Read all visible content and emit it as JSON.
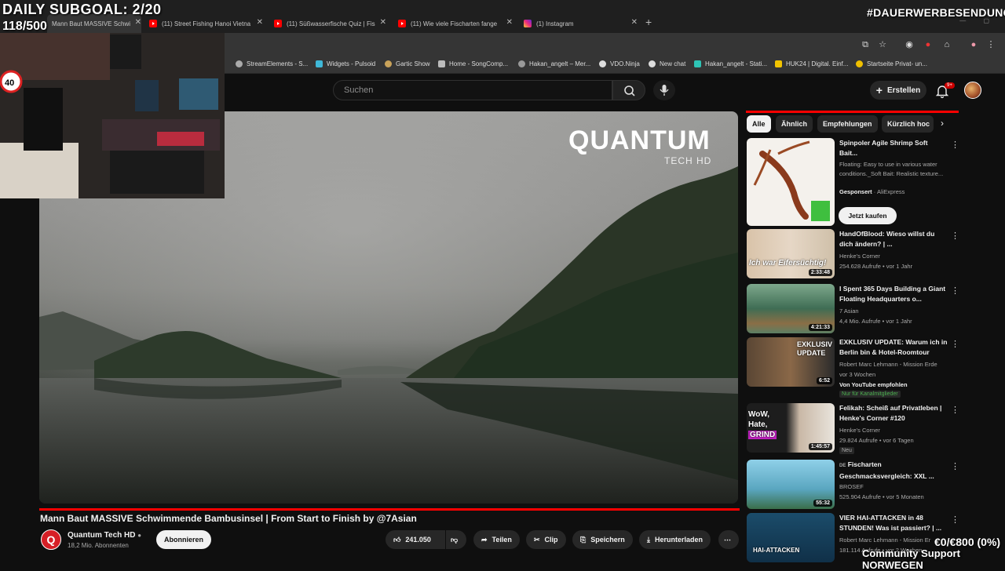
{
  "overlay": {
    "subgoal": "DAILY SUBGOAL: 2/20",
    "subcount": "118/500",
    "werbung": "#DAUERWERBESENDUNG",
    "donation": "€0/€800 (0%)",
    "support": "Community Support NORWEGEN"
  },
  "browser": {
    "tabs": [
      {
        "label": "Mann Baut MASSIVE Schwi",
        "icon": "youtube-icon",
        "active": true
      },
      {
        "label": "(11) Street Fishing Hanoi Vietna",
        "icon": "youtube-icon"
      },
      {
        "label": "(11) Süßwasserfische Quiz | Fis",
        "icon": "youtube-icon"
      },
      {
        "label": "(11) Wie viele Fischarten fange",
        "icon": "youtube-icon"
      },
      {
        "label": "(1) Instagram",
        "icon": "instagram-icon"
      }
    ],
    "bookmarks": [
      "StreamElements - S...",
      "Widgets - Pulsoid",
      "Gartic Show",
      "Home - SongComp...",
      "Hakan_angelt – Mer...",
      "VDO.Ninja",
      "New chat",
      "Hakan_angelt - Stati...",
      "HUK24 | Digital. Einf...",
      "Startseite Privat- un..."
    ]
  },
  "youtube": {
    "search_placeholder": "Suchen",
    "create_label": "Erstellen",
    "notification_count": "9+",
    "video": {
      "title": "Mann Baut MASSIVE Schwimmende Bambusinsel | From Start to Finish by @7Asian",
      "channel": "Quantum Tech HD",
      "subscribers": "18,2 Mio. Abonnenten",
      "subscribe_label": "Abonnieren",
      "likes": "241.050",
      "share_label": "Teilen",
      "clip_label": "Clip",
      "save_label": "Speichern",
      "download_label": "Herunterladen",
      "watermark_main": "QUANTUM",
      "watermark_sub": "TECH HD",
      "channel_initial": "Q"
    },
    "chips": [
      "Alle",
      "Ähnlich",
      "Empfehlungen",
      "Kürzlich hoc"
    ],
    "recommendations": [
      {
        "title": "Spinpoler Agile Shrimp Soft Bait...",
        "description": "Floating: Easy to use in various water conditions._Soft Bait: Realistic texture...",
        "sponsor": "Gesponsert",
        "advertiser": "AliExpress",
        "cta": "Jetzt kaufen"
      },
      {
        "title": "HandOfBlood: Wieso willst du dich ändern? | ...",
        "channel": "Henke's Corner",
        "meta": "254.628 Aufrufe • vor 1 Jahr",
        "duration": "2:33:48",
        "thumb_text": "Ich war Eifersüchtig!"
      },
      {
        "title": "I Spent 365 Days Building a Giant Floating Headquarters o...",
        "channel": "7 Asian",
        "meta": "4,4 Mio. Aufrufe • vor 1 Jahr",
        "duration": "4:21:33"
      },
      {
        "title": "EXKLUSIV UPDATE: Warum ich in Berlin bin & Hotel-Roomtour",
        "channel": "Robert Marc Lehmann - Mission Erde",
        "meta": "vor 3 Wochen",
        "extra": "Von YouTube empfohlen",
        "badge": "Nur für Kanalmitglieder",
        "duration": "6:52",
        "thumb_text": "EXKLUSIV UPDATE"
      },
      {
        "title": "Felikah: Scheiß auf Privatleben | Henke's Corner #120",
        "channel": "Henke's Corner",
        "meta": "29.824 Aufrufe • vor 6 Tagen",
        "badge": "Neu",
        "duration": "1:45:57",
        "thumb_text_1": "WoW,",
        "thumb_text_2": "Hate,",
        "thumb_text_3": "GRIND"
      },
      {
        "title": "Fischarten Geschmacksvergleich: XXL ...",
        "lang": "DE",
        "channel": "BROSEF",
        "meta": "525.904 Aufrufe • vor 5 Monaten",
        "duration": "55:32"
      },
      {
        "title": "VIER HAI-ATTACKEN in 48 STUNDEN! Was ist passiert? | ...",
        "channel": "Robert Marc Lehmann - Mission Er",
        "meta": "181.114 Aufrufe • vor 2 Wochen",
        "thumb_text": "HAI-ATTACKEN"
      }
    ]
  },
  "colors": {
    "accent": "#ff0000",
    "background": "#0f0f0f",
    "chip_active": "#f1f1f1"
  }
}
